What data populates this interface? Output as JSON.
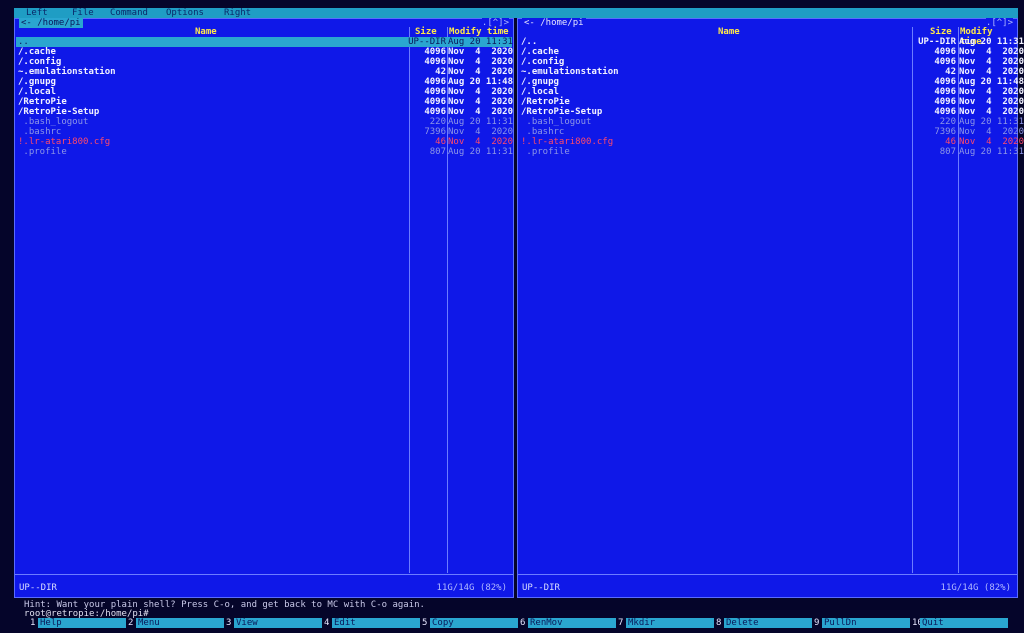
{
  "menubar": [
    "Left",
    "File",
    "Command",
    "Options",
    "Right"
  ],
  "left_panel": {
    "path": "<- /home/pi",
    "corner": ".[^]>",
    "headers": {
      "name": "Name",
      "size": "Size",
      "time": "Modify time"
    },
    "rows": [
      {
        "name": "..",
        "size": "UP--DIR",
        "time": "Aug 20 11:31",
        "kind": "sel"
      },
      {
        "name": "/.cache",
        "size": "4096",
        "time": "Nov  4  2020",
        "kind": "dir"
      },
      {
        "name": "/.config",
        "size": "4096",
        "time": "Nov  4  2020",
        "kind": "dir"
      },
      {
        "name": "~.emulationstation",
        "size": "42",
        "time": "Nov  4  2020",
        "kind": "dir"
      },
      {
        "name": "/.gnupg",
        "size": "4096",
        "time": "Aug 20 11:48",
        "kind": "dir"
      },
      {
        "name": "/.local",
        "size": "4096",
        "time": "Nov  4  2020",
        "kind": "dir"
      },
      {
        "name": "/RetroPie",
        "size": "4096",
        "time": "Nov  4  2020",
        "kind": "dir"
      },
      {
        "name": "/RetroPie-Setup",
        "size": "4096",
        "time": "Nov  4  2020",
        "kind": "dir"
      },
      {
        "name": " .bash_logout",
        "size": "220",
        "time": "Aug 20 11:31",
        "kind": "file"
      },
      {
        "name": " .bashrc",
        "size": "7396",
        "time": "Nov  4  2020",
        "kind": "file"
      },
      {
        "name": "!.lr-atari800.cfg",
        "size": "46",
        "time": "Nov  4  2020",
        "kind": "cfg"
      },
      {
        "name": " .profile",
        "size": "807",
        "time": "Aug 20 11:31",
        "kind": "file"
      }
    ],
    "mini_status": "UP--DIR",
    "free_space": "11G/14G (82%)"
  },
  "right_panel": {
    "path": "<- /home/pi",
    "corner": ".[^]>",
    "headers": {
      "name": "Name",
      "size": "Size",
      "time": "Modify time"
    },
    "rows": [
      {
        "name": "/..",
        "size": "UP--DIR",
        "time": "Aug 20 11:31",
        "kind": "dir"
      },
      {
        "name": "/.cache",
        "size": "4096",
        "time": "Nov  4  2020",
        "kind": "dir"
      },
      {
        "name": "/.config",
        "size": "4096",
        "time": "Nov  4  2020",
        "kind": "dir"
      },
      {
        "name": "~.emulationstation",
        "size": "42",
        "time": "Nov  4  2020",
        "kind": "dir"
      },
      {
        "name": "/.gnupg",
        "size": "4096",
        "time": "Aug 20 11:48",
        "kind": "dir"
      },
      {
        "name": "/.local",
        "size": "4096",
        "time": "Nov  4  2020",
        "kind": "dir"
      },
      {
        "name": "/RetroPie",
        "size": "4096",
        "time": "Nov  4  2020",
        "kind": "dir"
      },
      {
        "name": "/RetroPie-Setup",
        "size": "4096",
        "time": "Nov  4  2020",
        "kind": "dir"
      },
      {
        "name": " .bash_logout",
        "size": "220",
        "time": "Aug 20 11:31",
        "kind": "file"
      },
      {
        "name": " .bashrc",
        "size": "7396",
        "time": "Nov  4  2020",
        "kind": "file"
      },
      {
        "name": "!.lr-atari800.cfg",
        "size": "46",
        "time": "Nov  4  2020",
        "kind": "cfg"
      },
      {
        "name": " .profile",
        "size": "807",
        "time": "Aug 20 11:31",
        "kind": "file"
      }
    ],
    "mini_status": "UP--DIR",
    "free_space": "11G/14G (82%)"
  },
  "hint": "Hint: Want your plain shell? Press C-o, and get back to MC with C-o again.",
  "prompt": "root@retropie:/home/pi#",
  "fkeys": [
    {
      "num": "1",
      "label": "Help"
    },
    {
      "num": "2",
      "label": "Menu"
    },
    {
      "num": "3",
      "label": "View"
    },
    {
      "num": "4",
      "label": "Edit"
    },
    {
      "num": "5",
      "label": "Copy"
    },
    {
      "num": "6",
      "label": "RenMov"
    },
    {
      "num": "7",
      "label": "Mkdir"
    },
    {
      "num": "8",
      "label": "Delete"
    },
    {
      "num": "9",
      "label": "PullDn"
    },
    {
      "num": "10",
      "label": "Quit"
    }
  ]
}
